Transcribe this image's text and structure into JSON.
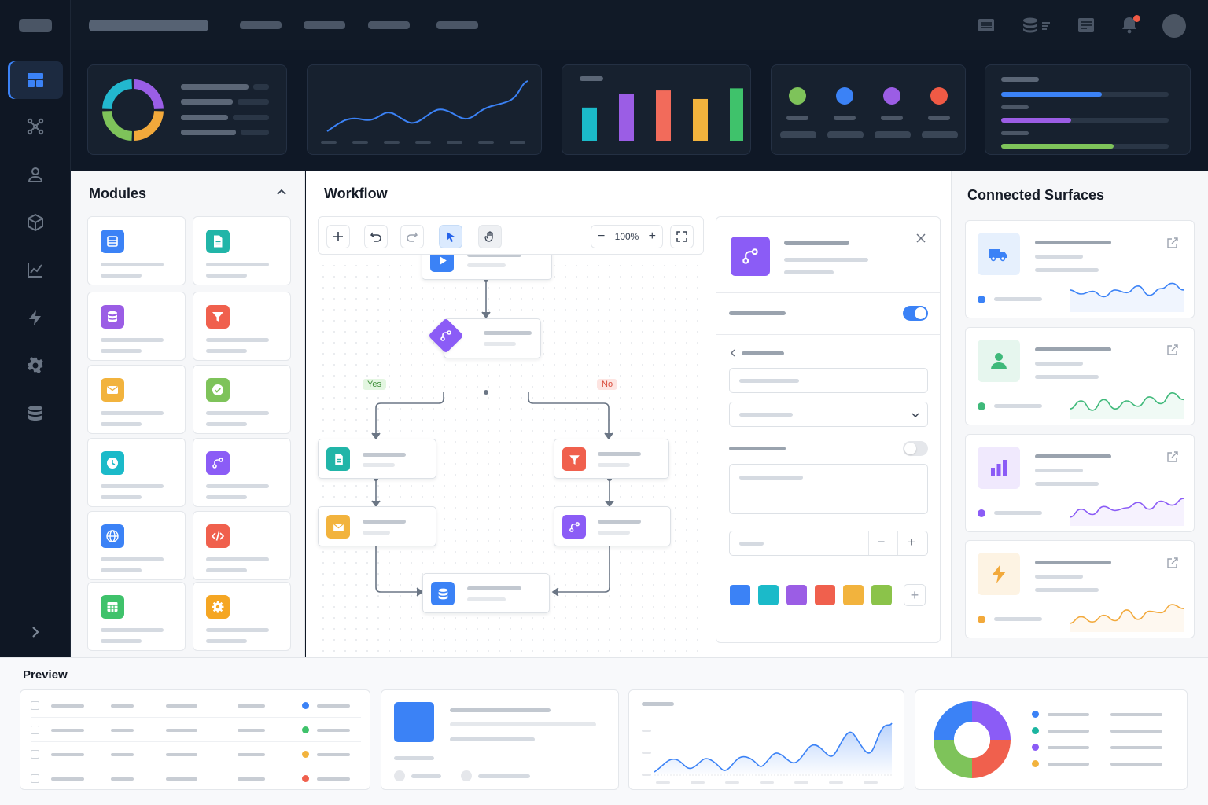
{
  "sidebar": {
    "items": [
      {
        "icon": "dashboard-icon",
        "active": true
      },
      {
        "icon": "workflow-graph-icon"
      },
      {
        "icon": "user-icon"
      },
      {
        "icon": "cube-icon"
      },
      {
        "icon": "analytics-icon"
      },
      {
        "icon": "bolt-icon"
      },
      {
        "icon": "settings-gear-icon"
      },
      {
        "icon": "database-icon"
      }
    ],
    "expand_icon": "chevron-right-icon"
  },
  "topbar": {
    "icons": [
      "list-icon",
      "database-filter-icon",
      "inbox-icon",
      "bell-icon"
    ],
    "notification_dot_color": "#f05a45"
  },
  "dashboard": {
    "donut_colors": [
      "#9a5ee6",
      "#f2a93b",
      "#7ec35a",
      "#22b8cf"
    ],
    "bar_chart_colors": [
      "#1bbac9",
      "#9b5de5",
      "#f26b5b",
      "#f2b33d",
      "#3fc26b"
    ],
    "bar_chart_values": [
      0.62,
      0.88,
      0.94,
      0.78,
      0.98
    ],
    "status_dots": [
      "#7ec35a",
      "#3b82f6",
      "#9b5de5",
      "#f05a45"
    ],
    "progress": [
      {
        "color": "#3b82f6",
        "value": 0.6
      },
      {
        "color": "#9b5de5",
        "value": 0.42
      },
      {
        "color": "#7ec35a",
        "value": 0.67
      }
    ]
  },
  "modules": {
    "title": "Modules",
    "collapse_icon": "chevron-up-icon",
    "items": [
      {
        "icon": "layout-icon",
        "color": "#3b82f6"
      },
      {
        "icon": "document-icon",
        "color": "#21b5a8"
      },
      {
        "icon": "database-icon",
        "color": "#9b5de5"
      },
      {
        "icon": "filter-icon",
        "color": "#f0604d"
      },
      {
        "icon": "mail-icon",
        "color": "#f2b33d"
      },
      {
        "icon": "check-shield-icon",
        "color": "#7ec35a"
      },
      {
        "icon": "clock-icon",
        "color": "#1bbac9"
      },
      {
        "icon": "branch-icon",
        "color": "#8b5cf6"
      },
      {
        "icon": "globe-icon",
        "color": "#3b82f6"
      },
      {
        "icon": "code-icon",
        "color": "#f0604d"
      },
      {
        "icon": "table-icon",
        "color": "#3fc26b"
      },
      {
        "icon": "gear-icon",
        "color": "#f5a623"
      }
    ]
  },
  "workflow": {
    "title": "Workflow",
    "zoom": "100%",
    "branch_yes": "Yes",
    "branch_no": "No"
  },
  "props": {
    "toggle1_on": true,
    "toggle2_on": false,
    "swatches": [
      "#3b82f6",
      "#1bbac9",
      "#9b5de5",
      "#f0604d",
      "#f2b33d",
      "#8bc34a"
    ]
  },
  "surfaces": {
    "title": "Connected Surfaces",
    "items": [
      {
        "icon": "truck-icon",
        "color": "#3b82f6",
        "bg": "#e6f0fd",
        "spark": [
          0.35,
          0.5,
          0.4,
          0.6,
          0.35,
          0.45,
          0.2,
          0.55,
          0.3,
          0.1,
          0.35
        ]
      },
      {
        "icon": "person-icon",
        "color": "#3fb97a",
        "bg": "#e6f6ee",
        "spark": [
          0.8,
          0.5,
          0.85,
          0.45,
          0.8,
          0.5,
          0.7,
          0.35,
          0.6,
          0.2,
          0.45
        ]
      },
      {
        "icon": "bar-chart-icon",
        "color": "#8b5cf6",
        "bg": "#f0e9fd",
        "spark": [
          0.85,
          0.55,
          0.75,
          0.45,
          0.6,
          0.5,
          0.3,
          0.55,
          0.25,
          0.4,
          0.15
        ]
      },
      {
        "icon": "bolt-icon",
        "color": "#f2a93b",
        "bg": "#fdf3e3",
        "spark": [
          0.85,
          0.6,
          0.8,
          0.55,
          0.75,
          0.35,
          0.7,
          0.4,
          0.45,
          0.15,
          0.3
        ]
      }
    ]
  },
  "preview": {
    "title": "Preview",
    "row_dots": [
      "#3b82f6",
      "#3fc26b",
      "#f2b33d",
      "#f0604d"
    ],
    "media_color": "#3b82f6",
    "donut_colors": [
      "#8b5cf6",
      "#f0604d",
      "#7ec35a",
      "#3b82f6"
    ],
    "legend_dots": [
      "#3b82f6",
      "#1bb5a0",
      "#8b5cf6",
      "#f2b33d"
    ]
  }
}
